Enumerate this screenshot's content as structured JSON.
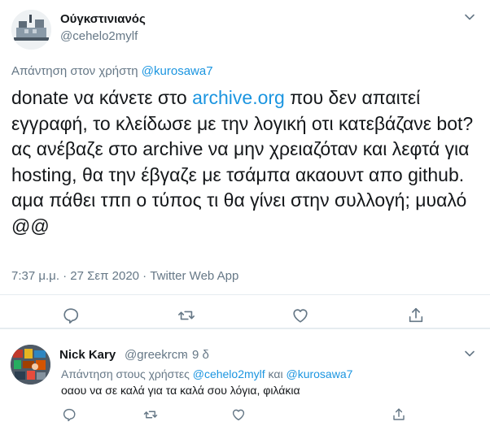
{
  "main_tweet": {
    "author_name": "Ούγκστινιανός",
    "author_handle": "@cehelo2mylf",
    "reply_prefix": "Απάντηση στον χρήστη",
    "reply_mention": "@kurosawa7",
    "text_part1": "donate να κάνετε στο ",
    "text_link": "archive.org",
    "text_part2": " που δεν απαιτεί εγγραφή, το κλείδωσε με την λογική οτι κατεβάζανε bot? ας ανέβαζε στο archive να μην χρειαζόταν και λεφτά για hosting, θα την έβγαζε με τσάμπα ακαουντ απο github.",
    "text_line2": "αμα πάθει τπп ο τύπος τι θα γίνει στην συλλογή; μυαλό @@",
    "meta": "7:37 μ.μ. · 27 Σεπ 2020 · Twitter Web App"
  },
  "reply_tweet": {
    "author_name": "Nick Kary",
    "author_handle": "@greekrcm",
    "dot": "·",
    "time": "9 δ",
    "reply_prefix": "Απάντηση στους χρήστες",
    "mention1": "@cehelo2mylf",
    "and_word": "και",
    "mention2": "@kurosawa7",
    "text": "οαου να σε καλά για τα καλά σου λόγια, φιλάκια"
  },
  "icons": {
    "reply": "reply-icon",
    "retweet": "retweet-icon",
    "like": "heart-icon",
    "share": "share-icon",
    "more": "chevron-down-icon"
  },
  "colors": {
    "link": "#1b95e0",
    "secondary_text": "#657786",
    "primary_text": "#14171a",
    "divider": "#e6ecf0"
  }
}
